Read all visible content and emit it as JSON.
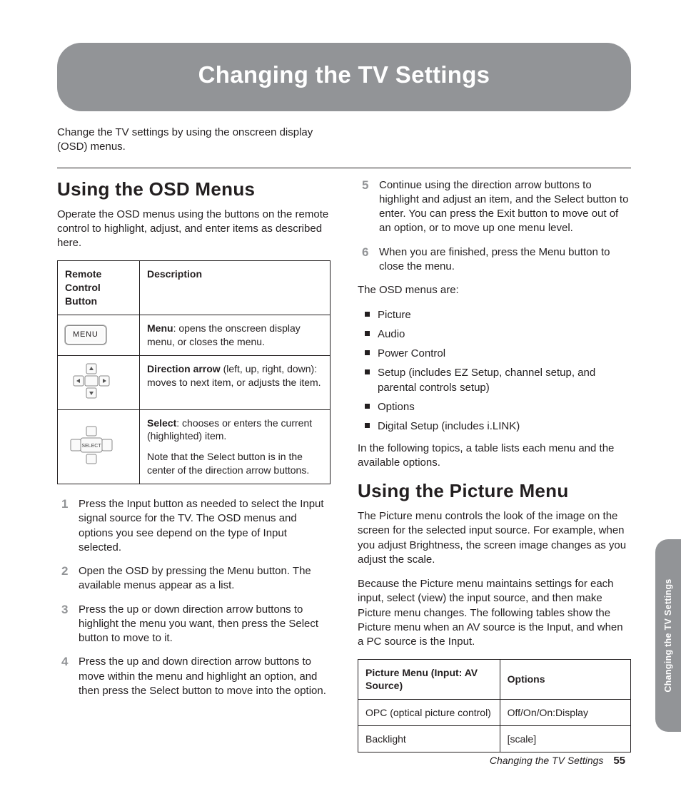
{
  "banner_title": "Changing the TV Settings",
  "intro": "Change the TV settings by using the onscreen display (OSD) menus.",
  "h2_osd": "Using the OSD Menus",
  "osd_intro": "Operate the OSD menus using the buttons on the remote control to highlight, adjust, and enter items as described here.",
  "table1": {
    "h1": "Remote Control Button",
    "h2": "Description",
    "menu_label": "MENU",
    "r1_bold": "Menu",
    "r1_rest": ": opens the onscreen display menu, or closes the menu.",
    "r2_bold": "Direction arrow",
    "r2_rest": " (left, up, right, down): moves to next item, or adjusts the item.",
    "select_label": "SELECT",
    "r3_bold": "Select",
    "r3_rest": ": chooses or enters the current (highlighted) item.",
    "r3_note": "Note that the Select button is in the center of the direction arrow buttons."
  },
  "steps14": [
    "Press the Input button as needed to select the Input signal source for the TV. The OSD menus and options you see depend on the type of Input selected.",
    "Open the OSD by pressing the Menu button. The available menus appear as a list.",
    "Press the up or down direction arrow buttons to highlight the menu you want, then press the Select button to move to it.",
    "Press the up and down direction arrow buttons to move within the menu and highlight an option, and then press the Select button to move into the option."
  ],
  "steps56": [
    "Continue using the direction arrow buttons to highlight and adjust an item, and the Select button to enter. You can press the Exit button to move out of an option, or to move up one menu level.",
    "When you are finished, press the Menu button to close the menu."
  ],
  "menus_intro": "The OSD menus are:",
  "menus": [
    "Picture",
    "Audio",
    "Power Control",
    "Setup (includes EZ Setup, channel setup, and parental controls setup)",
    "Options",
    "Digital Setup (includes i.LINK)"
  ],
  "after_menus": "In the following topics, a table lists each menu and the available options.",
  "h2_picture": "Using the Picture Menu",
  "picture_p1": "The Picture menu controls the look of the image on the screen for the selected input source. For example, when you adjust Brightness, the screen image changes as you adjust the scale.",
  "picture_p2": "Because the Picture menu maintains settings for each input, select (view) the input source, and then make Picture menu changes. The following tables show the Picture menu when an AV source is the Input, and when a PC source is the Input.",
  "pic_table": {
    "h1": "Picture Menu (Input: AV Source)",
    "h2": "Options",
    "rows": [
      {
        "a": "OPC (optical picture control)",
        "b": "Off/On/On:Display"
      },
      {
        "a": "Backlight",
        "b": "[scale]"
      }
    ]
  },
  "side_tab": "Changing the TV Settings",
  "footer_title": "Changing the TV Settings",
  "page_num": "55"
}
